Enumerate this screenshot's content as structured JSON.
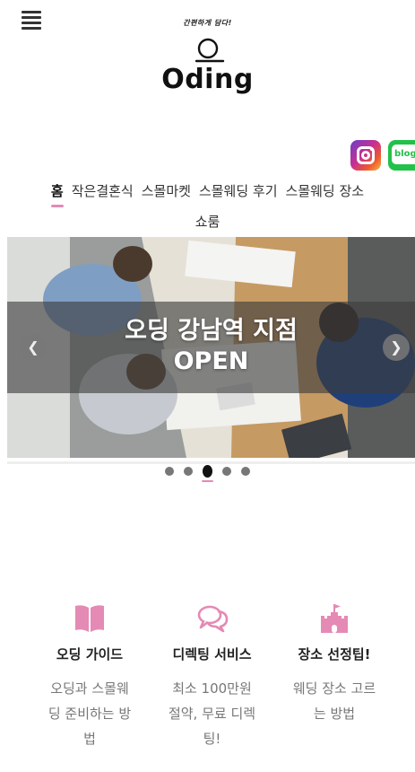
{
  "header": {
    "tagline": "간편하게 담다!",
    "logo_text": "Oding",
    "menu_icon": "hamburger-menu-icon"
  },
  "social": {
    "instagram_icon": "instagram-icon",
    "blog_icon": "naver-blog-icon",
    "blog_label": "blog",
    "instagram_color": "#c72f92",
    "blog_color": "#22c14a"
  },
  "nav": {
    "items": [
      {
        "label": "홈"
      },
      {
        "label": "작은결혼식"
      },
      {
        "label": "스몰마켓"
      },
      {
        "label": "스몰웨딩 후기"
      },
      {
        "label": "스몰웨딩 장소"
      }
    ],
    "wrap_label": "쇼룸",
    "accent_color": "#e48ab5"
  },
  "slider": {
    "caption_line1": "오딩 강남역 지점",
    "caption_line2": "OPEN",
    "prev_icon": "chevron-left-icon",
    "next_icon": "chevron-right-icon",
    "prev_glyph": "❮",
    "next_glyph": "❯",
    "slide_count": 5,
    "active_slide": 3
  },
  "features": [
    {
      "title": "오딩 가이드",
      "desc": [
        "오딩과 스몰웨",
        "딩 준비하는 방",
        "법"
      ],
      "icon": "book-icon"
    },
    {
      "title": "디렉팅 서비스",
      "desc": [
        "최소 100만원",
        "절약, 무료 디렉",
        "팅!"
      ],
      "icon": "chat-bubbles-icon"
    },
    {
      "title": "장소 선정팁!",
      "desc": [
        "웨딩 장소 고르",
        "는 방법"
      ],
      "icon": "castle-icon"
    }
  ],
  "colors": {
    "icon_pink": "#e48ab5"
  }
}
